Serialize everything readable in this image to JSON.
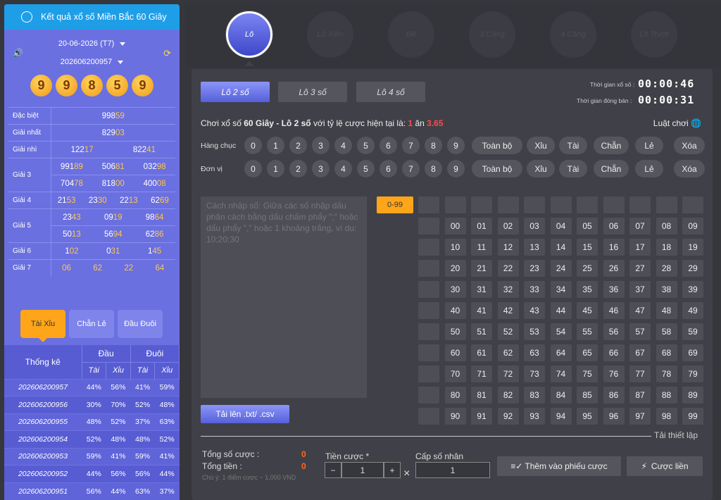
{
  "left": {
    "title": "Kết quả xổ số Miền Bắc 60 Giây",
    "date": "20-06-2026 (T7)",
    "draw_id": "202606200957",
    "balls": [
      "9",
      "9",
      "8",
      "5",
      "9"
    ],
    "prizes": [
      {
        "label": "Đặc biệt",
        "rows": [
          [
            [
              "998",
              "59"
            ]
          ]
        ]
      },
      {
        "label": "Giải nhất",
        "rows": [
          [
            [
              "829",
              "03"
            ]
          ]
        ]
      },
      {
        "label": "Giải nhì",
        "rows": [
          [
            [
              "122",
              "17"
            ],
            [
              "822",
              "41"
            ]
          ]
        ]
      },
      {
        "label": "Giải 3",
        "rows": [
          [
            [
              "991",
              "89"
            ],
            [
              "506",
              "81"
            ],
            [
              "032",
              "98"
            ]
          ],
          [
            [
              "704",
              "78"
            ],
            [
              "818",
              "00"
            ],
            [
              "400",
              "08"
            ]
          ]
        ]
      },
      {
        "label": "Giải 4",
        "rows": [
          [
            [
              "21",
              "53"
            ],
            [
              "23",
              "30"
            ],
            [
              "22",
              "13"
            ],
            [
              "62",
              "69"
            ]
          ]
        ]
      },
      {
        "label": "Giải 5",
        "rows": [
          [
            [
              "23",
              "43"
            ],
            [
              "09",
              "19"
            ],
            [
              "98",
              "64"
            ]
          ],
          [
            [
              "50",
              "13"
            ],
            [
              "56",
              "94"
            ],
            [
              "62",
              "86"
            ]
          ]
        ]
      },
      {
        "label": "Giải 6",
        "rows": [
          [
            [
              "1",
              "02"
            ],
            [
              "0",
              "31"
            ],
            [
              "1",
              "45"
            ]
          ]
        ]
      },
      {
        "label": "Giải 7",
        "rows": [
          [
            [
              "",
              "06"
            ],
            [
              "",
              "62"
            ],
            [
              "",
              "22"
            ],
            [
              "",
              "64"
            ]
          ]
        ]
      }
    ],
    "stat_tabs": [
      "Tài Xỉu",
      "Chẵn Lẻ",
      "Đầu Đuôi"
    ],
    "stats_head": {
      "title": "Thống kê",
      "dau": "Đầu",
      "duoi": "Đuôi",
      "tai": "Tài",
      "xiu": "Xỉu"
    },
    "stats": [
      [
        "202606200957",
        "44%",
        "56%",
        "41%",
        "59%"
      ],
      [
        "202606200956",
        "30%",
        "70%",
        "52%",
        "48%"
      ],
      [
        "202606200955",
        "48%",
        "52%",
        "37%",
        "63%"
      ],
      [
        "202606200954",
        "52%",
        "48%",
        "48%",
        "52%"
      ],
      [
        "202606200953",
        "59%",
        "41%",
        "59%",
        "41%"
      ],
      [
        "202606200952",
        "44%",
        "56%",
        "56%",
        "44%"
      ],
      [
        "202606200951",
        "56%",
        "44%",
        "63%",
        "37%"
      ]
    ]
  },
  "game_tabs": [
    "Lô",
    "Lô Xiên",
    "Đề",
    "3 Càng",
    "4 Càng",
    "Lô Trượt"
  ],
  "lo_tabs": [
    "Lô 2 số",
    "Lô 3 số",
    "Lô 4 số"
  ],
  "timer": {
    "draw_label": "Thời gian xổ số :",
    "draw_val": "00:00:46",
    "close_label": "Thời gian đóng bán :",
    "close_val": "00:00:31"
  },
  "info": {
    "prefix": "Chơi xổ số ",
    "game": "60 Giây - Lô 2 số",
    "mid": " với tỷ lệ cược hiện tại là: ",
    "r1": "1",
    "an": " ăn ",
    "r2": "3.65"
  },
  "rules": "Luật chơi",
  "row_labels": [
    "Hàng chục",
    "Đơn vị"
  ],
  "digits": [
    "0",
    "1",
    "2",
    "3",
    "4",
    "5",
    "6",
    "7",
    "8",
    "9"
  ],
  "actions": [
    "Toàn bộ",
    "Xỉu",
    "Tài",
    "Chẵn",
    "Lẻ",
    "Xóa"
  ],
  "textarea_placeholder": "Cách nhập số: Giữa các số nhập dấu phân cách bằng dấu chấm phẩy \";\" hoặc dấu phẩy \",\" hoặc 1 khoảng trắng, ví dụ: 10;20;30",
  "upload": "Tải lên .txt/ .csv",
  "range": "0-99",
  "reset": "Tải thiết lập",
  "summary": {
    "total_bets_label": "Tổng số cược :",
    "total_bets": "0",
    "total_money_label": "Tổng tiền :",
    "total_money": "0",
    "note": "Chú ý: 1 điểm cược ~ 1,000 VND"
  },
  "stake": {
    "label": "Tiền cược *",
    "value": "1",
    "minus": "−",
    "plus": "+",
    "times": "×"
  },
  "multiplier": {
    "label": "Cấp số nhân",
    "value": "1"
  },
  "buttons": {
    "add": "Thêm vào phiếu cược",
    "quick": "Cược liền"
  }
}
